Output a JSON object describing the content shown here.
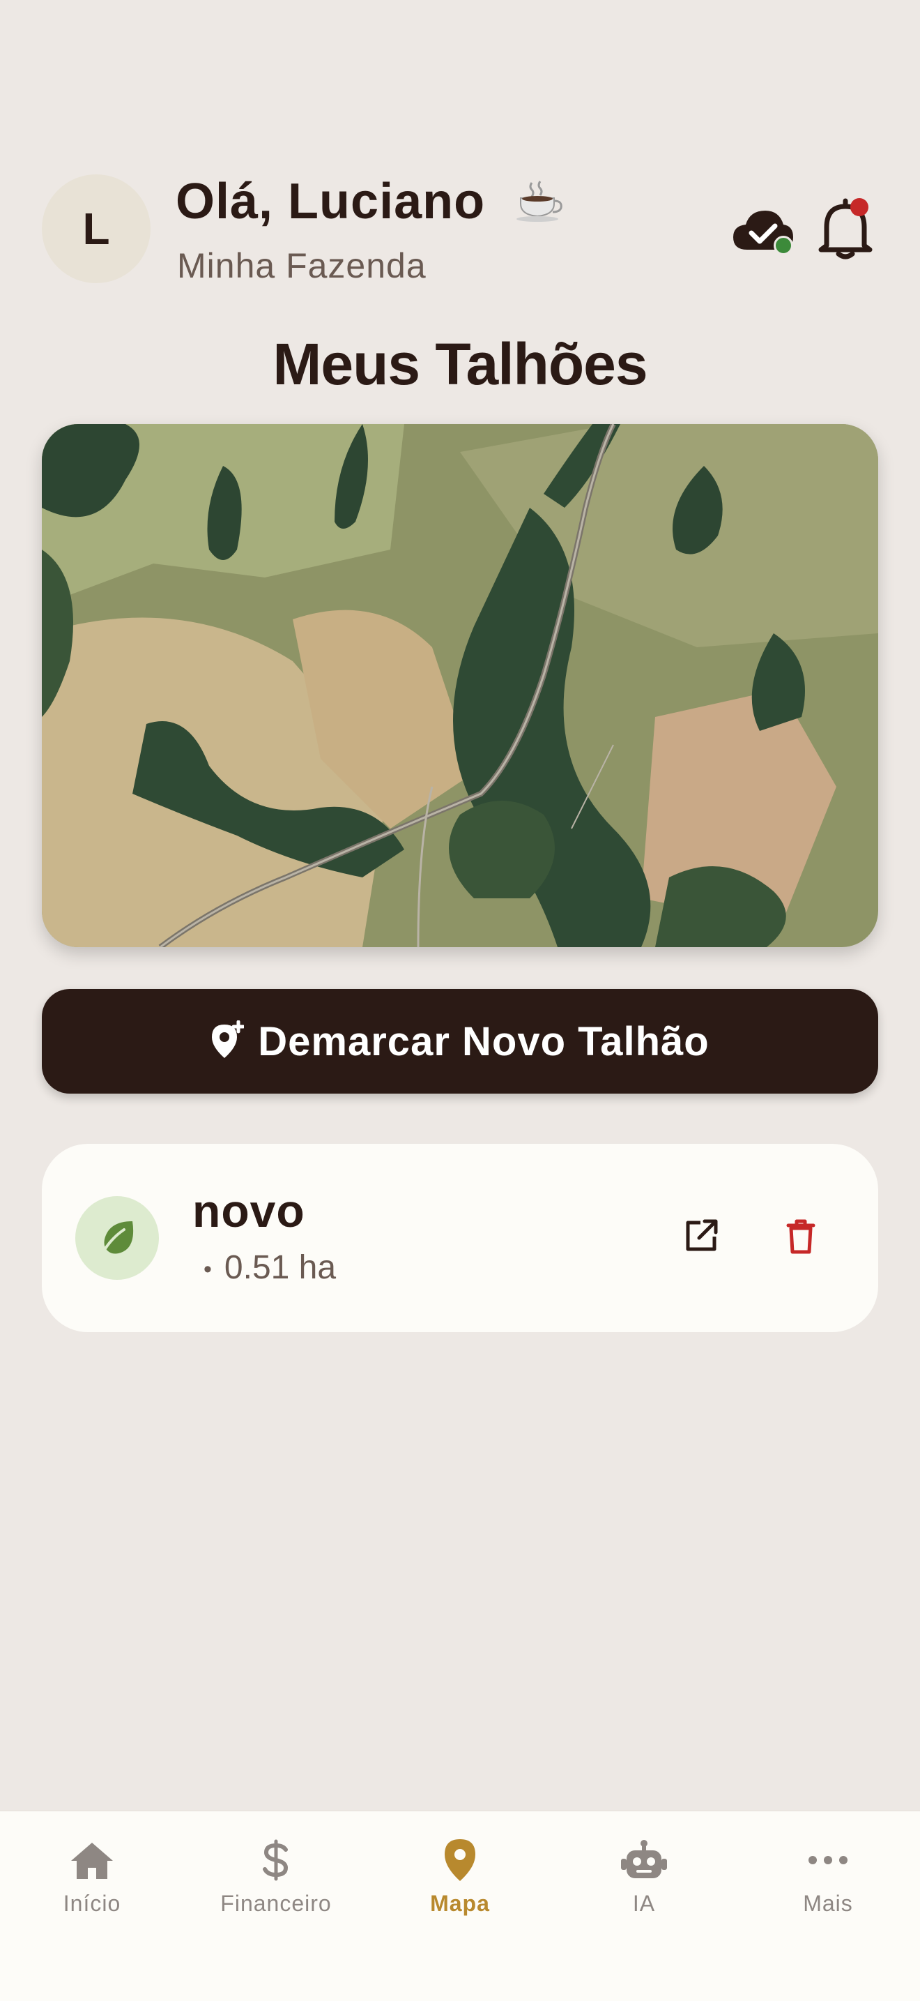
{
  "header": {
    "avatar_initial": "L",
    "greeting": "Olá, Luciano",
    "greeting_emoji_icon": "coffee-cup-icon",
    "farm_name": "Minha Fazenda",
    "sync_status": "synced",
    "notifications": {
      "has_unread": true
    }
  },
  "page": {
    "title": "Meus Talhões"
  },
  "map": {
    "type": "satellite"
  },
  "cta": {
    "label": "Demarcar Novo Talhão",
    "icon": "add-location-icon"
  },
  "plots": [
    {
      "name": "novo",
      "area": "0.51 ha",
      "icon": "leaf-icon"
    }
  ],
  "nav": {
    "items": [
      {
        "label": "Início",
        "icon": "home-icon"
      },
      {
        "label": "Financeiro",
        "icon": "dollar-icon"
      },
      {
        "label": "Mapa",
        "icon": "map-pin-icon",
        "active": true
      },
      {
        "label": "IA",
        "icon": "robot-icon"
      },
      {
        "label": "Mais",
        "icon": "more-icon"
      }
    ]
  },
  "colors": {
    "background": "#EDE8E4",
    "primary_dark": "#2B1A15",
    "accent_gold": "#B8892E",
    "danger": "#C62828",
    "leaf_green": "#5E8B3A",
    "online_green": "#3C8A3A"
  }
}
